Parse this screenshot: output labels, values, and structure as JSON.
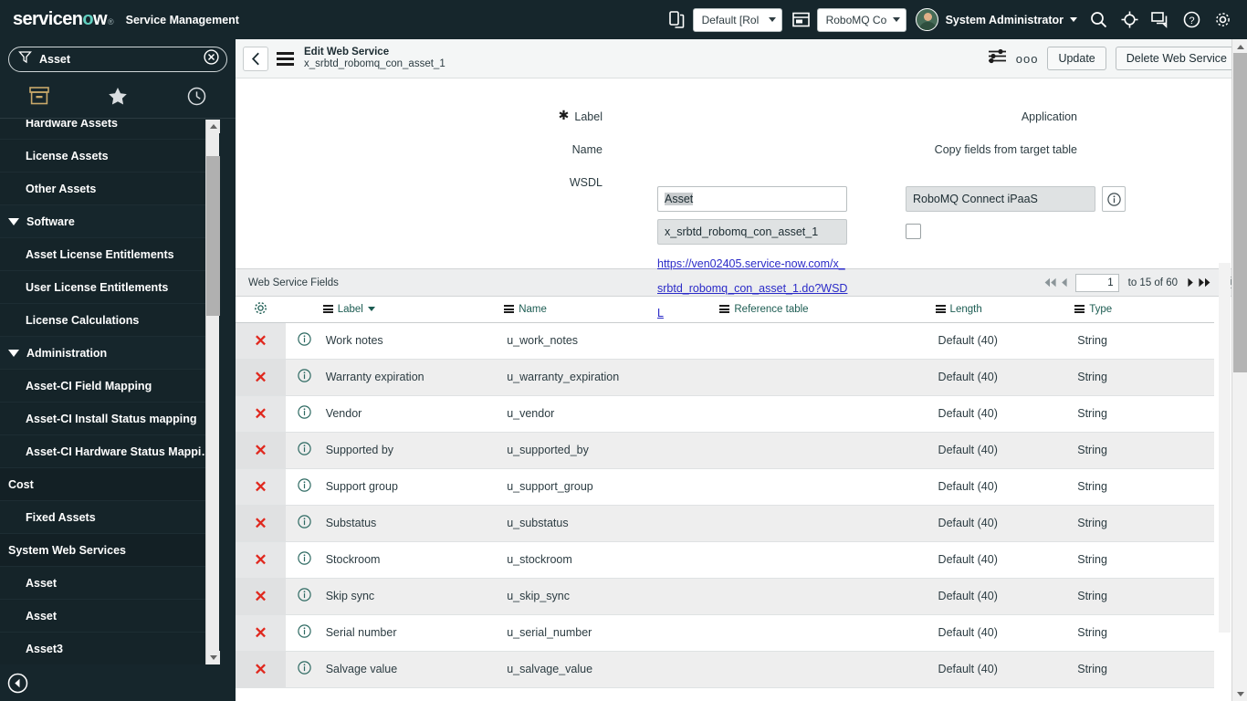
{
  "banner": {
    "logo": "servicenow",
    "product": "Service Management",
    "impersonate_value": "Default [Rol",
    "app_value": "RoboMQ Co",
    "user_name": "System Administrator",
    "icons": [
      "copy-icon",
      "calendar-icon",
      "search-icon",
      "target-icon",
      "conversation-icon",
      "help-icon",
      "gear-icon"
    ]
  },
  "sidebar": {
    "filter_value": "Asset",
    "tabs": [
      "all-applications-icon",
      "favorites-star-icon",
      "history-clock-icon"
    ],
    "items": [
      {
        "label": "Hardware Assets",
        "type": "module",
        "partial": true
      },
      {
        "label": "License Assets",
        "type": "module"
      },
      {
        "label": "Other Assets",
        "type": "module"
      },
      {
        "label": "Software",
        "type": "group",
        "expanded": true
      },
      {
        "label": "Asset License Entitlements",
        "type": "module"
      },
      {
        "label": "User License Entitlements",
        "type": "module"
      },
      {
        "label": "License Calculations",
        "type": "module"
      },
      {
        "label": "Administration",
        "type": "group",
        "expanded": true
      },
      {
        "label": "Asset-CI Field Mapping",
        "type": "module"
      },
      {
        "label": "Asset-CI Install Status mapping",
        "type": "module"
      },
      {
        "label": "Asset-CI Hardware Status Mappi…",
        "type": "module"
      },
      {
        "label": "Cost",
        "type": "section"
      },
      {
        "label": "Fixed Assets",
        "type": "module"
      },
      {
        "label": "System Web Services",
        "type": "section"
      },
      {
        "label": "Asset",
        "type": "module"
      },
      {
        "label": "Asset",
        "type": "module"
      },
      {
        "label": "Asset3",
        "type": "module"
      }
    ],
    "collapse_icon": "collapse-nav-icon"
  },
  "content_header": {
    "back_icon": "back-chevron-icon",
    "menu_icon": "context-menu-icon",
    "title": "Edit Web Service",
    "subtitle": "x_srbtd_robomq_con_asset_1",
    "personalize_icon": "personalize-form-icon",
    "more_label": "ooo",
    "update_label": "Update",
    "delete_label": "Delete Web Service"
  },
  "form": {
    "label_field": {
      "label": "Label",
      "value": "Asset",
      "required": true
    },
    "name_field": {
      "label": "Name",
      "value": "x_srbtd_robomq_con_asset_1",
      "readonly": true
    },
    "wsdl_field": {
      "label": "WSDL",
      "value": "https://ven02405.service-now.com/x_srbtd_robomq_con_asset_1.do?WSDL"
    },
    "application_field": {
      "label": "Application",
      "value": "RoboMQ Connect iPaaS",
      "readonly": true,
      "info_icon": "info-circle-icon"
    },
    "copy_fields_field": {
      "label": "Copy fields from target table",
      "checked": false
    }
  },
  "related_list": {
    "title": "Web Service Fields",
    "pager": {
      "first_icon": "first-page-icon",
      "prev_icon": "previous-page-icon",
      "page_value": "1",
      "range_text": "to 15 of 60",
      "next_icon": "next-page-icon",
      "last_icon": "last-page-icon",
      "collapse_icon": "collapse-list-icon"
    },
    "columns": [
      {
        "key": "gear",
        "label": "",
        "icon": "list-settings-gear-icon"
      },
      {
        "key": "info",
        "label": ""
      },
      {
        "key": "label",
        "label": "Label",
        "sorted": true,
        "sort_dir": "desc"
      },
      {
        "key": "name",
        "label": "Name"
      },
      {
        "key": "reference_table",
        "label": "Reference table"
      },
      {
        "key": "length",
        "label": "Length"
      },
      {
        "key": "type",
        "label": "Type"
      }
    ],
    "rows": [
      {
        "label": "Work notes",
        "name": "u_work_notes",
        "reference_table": "",
        "length": "Default (40)",
        "type": "String"
      },
      {
        "label": "Warranty expiration",
        "name": "u_warranty_expiration",
        "reference_table": "",
        "length": "Default (40)",
        "type": "String"
      },
      {
        "label": "Vendor",
        "name": "u_vendor",
        "reference_table": "",
        "length": "Default (40)",
        "type": "String"
      },
      {
        "label": "Supported by",
        "name": "u_supported_by",
        "reference_table": "",
        "length": "Default (40)",
        "type": "String"
      },
      {
        "label": "Support group",
        "name": "u_support_group",
        "reference_table": "",
        "length": "Default (40)",
        "type": "String"
      },
      {
        "label": "Substatus",
        "name": "u_substatus",
        "reference_table": "",
        "length": "Default (40)",
        "type": "String"
      },
      {
        "label": "Stockroom",
        "name": "u_stockroom",
        "reference_table": "",
        "length": "Default (40)",
        "type": "String"
      },
      {
        "label": "Skip sync",
        "name": "u_skip_sync",
        "reference_table": "",
        "length": "Default (40)",
        "type": "String"
      },
      {
        "label": "Serial number",
        "name": "u_serial_number",
        "reference_table": "",
        "length": "Default (40)",
        "type": "String"
      },
      {
        "label": "Salvage value",
        "name": "u_salvage_value",
        "reference_table": "",
        "length": "Default (40)",
        "type": "String"
      }
    ],
    "delete_icon": "delete-row-x-icon",
    "info_icon": "preview-record-info-icon"
  },
  "colors": {
    "banner_bg": "#16262c",
    "brand_accent": "#62d0c0",
    "progress_fill": "#1f8ac0",
    "delete_x": "#e0281e",
    "link": "#2b2bc8",
    "column_header_text": "#1c5c52"
  }
}
